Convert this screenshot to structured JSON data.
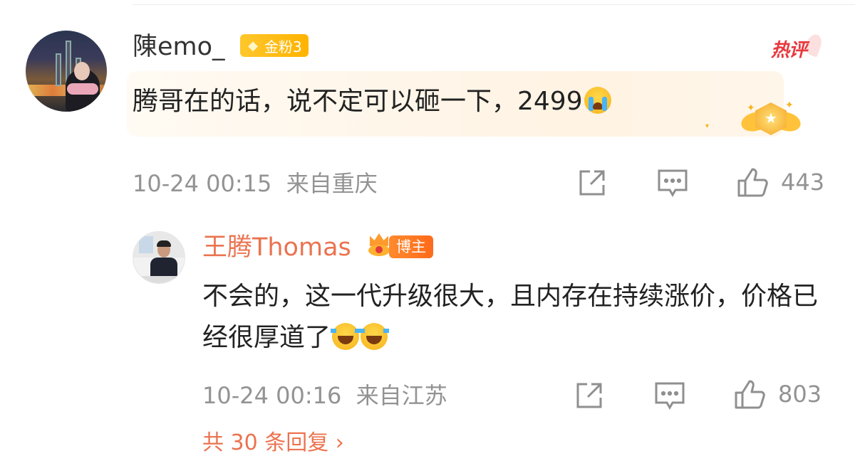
{
  "comment": {
    "username": "陳emo_",
    "fan_badge": "金粉3",
    "hot_label": "热评",
    "text": "腾哥在的话，说不定可以砸一下，2499",
    "emoji": "crying-emoji",
    "timestamp": "10-24 00:15",
    "location": "来自重庆",
    "likes": "443"
  },
  "reply": {
    "username": "王腾Thomas",
    "role_badge": "博主",
    "text": "不会的，这一代升级很大，且内存在持续涨价，价格已经很厚道了",
    "emoji": "laughing-crying-emoji",
    "timestamp": "10-24 00:16",
    "location": "来自江苏",
    "likes": "803"
  },
  "more_replies": "共 30 条回复 ›",
  "colors": {
    "accent": "#eb7350",
    "meta_gray": "#939393",
    "hot_red": "#e8383d",
    "gold": "#ffb300"
  }
}
